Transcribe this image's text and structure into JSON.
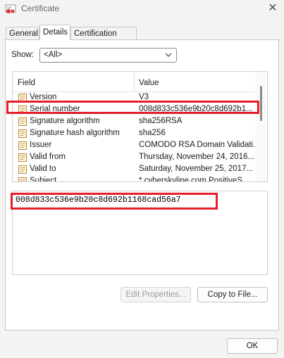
{
  "window": {
    "title": "Certificate"
  },
  "tabs": [
    {
      "label": "General"
    },
    {
      "label": "Details"
    },
    {
      "label": "Certification Path"
    }
  ],
  "show": {
    "label": "Show:",
    "selected": "<All>"
  },
  "list": {
    "headers": {
      "field": "Field",
      "value": "Value"
    },
    "rows": [
      {
        "field": "Version",
        "value": "V3"
      },
      {
        "field": "Serial number",
        "value": "008d833c536e9b20c8d692b1..."
      },
      {
        "field": "Signature algorithm",
        "value": "sha256RSA"
      },
      {
        "field": "Signature hash algorithm",
        "value": "sha256"
      },
      {
        "field": "Issuer",
        "value": "COMODO RSA Domain Validati..."
      },
      {
        "field": "Valid from",
        "value": "Thursday, November 24, 2016..."
      },
      {
        "field": "Valid to",
        "value": "Saturday, November 25, 2017..."
      },
      {
        "field": "Subject",
        "value": "* cyberskyline com PositiveS..."
      }
    ]
  },
  "detail_value": "008d833c536e9b20c8d692b1168cad56a7",
  "buttons": {
    "edit_properties": "Edit Properties...",
    "copy_to_file": "Copy to File...",
    "ok": "OK"
  },
  "colors": {
    "highlight": "#e41e2b"
  }
}
